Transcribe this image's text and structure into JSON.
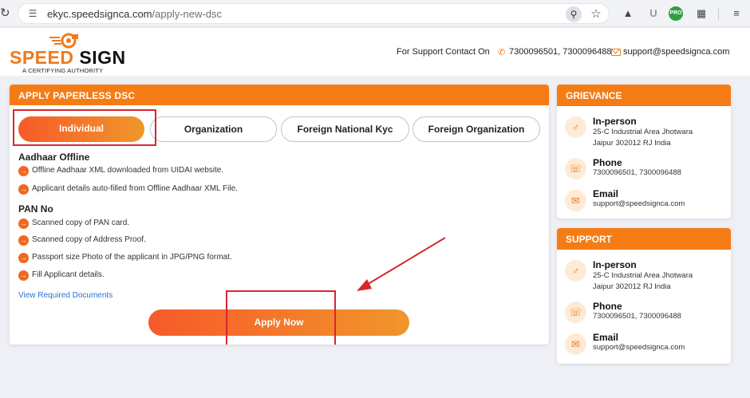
{
  "browser": {
    "url_host": "ekyc.speedsignca.com",
    "url_path": "/apply-new-dsc"
  },
  "header": {
    "logo_speed": "SPEED",
    "logo_sign": "SIGN",
    "logo_sub": "A CERTIFYING AUTHORITY",
    "support_label": "For Support Contact On",
    "phone": "7300096501, 7300096488",
    "email": "support@speedsignca.com"
  },
  "main": {
    "title": "APPLY PAPERLESS DSC",
    "tabs": [
      {
        "label": "Individual"
      },
      {
        "label": "Organization"
      },
      {
        "label": "Foreign National Kyc"
      },
      {
        "label": "Foreign Organization"
      }
    ],
    "sections": [
      {
        "title": "Aadhaar Offline",
        "items": [
          "Offline Aadhaar XML downloaded from UIDAI website.",
          "Applicant details auto-filled from Offline Aadhaar XML File."
        ]
      },
      {
        "title": "PAN No",
        "items": [
          "Scanned copy of PAN card.",
          "Scanned copy of Address Proof.",
          "Passport size Photo of the applicant in JPG/PNG format.",
          "Fill Applicant details."
        ]
      }
    ],
    "required_docs_link": "View Required Documents",
    "apply_label": "Apply Now"
  },
  "grievance": {
    "title": "GRIEVANCE",
    "inperson_label": "In-person",
    "address_line1": "25-C Industrial Area Jhotwara",
    "address_line2": "Jaipur 302012 RJ India",
    "phone_label": "Phone",
    "phone": "7300096501, 7300096488",
    "email_label": "Email",
    "email": "support@speedsignca.com"
  },
  "support": {
    "title": "SUPPORT",
    "inperson_label": "In-person",
    "address_line1": "25-C Industrial Area Jhotwara",
    "address_line2": "Jaipur 302012 RJ India",
    "phone_label": "Phone",
    "phone": "7300096501, 7300096488",
    "email_label": "Email",
    "email": "support@speedsignca.com"
  },
  "colors": {
    "brand_orange": "#f57c15",
    "highlight_red": "#d9262c",
    "link_blue": "#2b73d6"
  }
}
